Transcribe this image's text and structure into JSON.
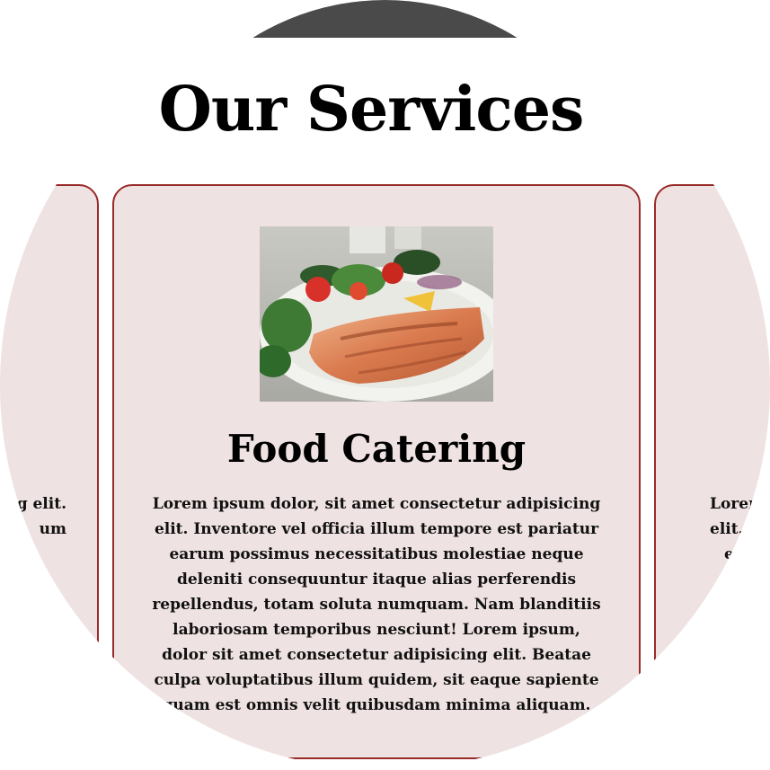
{
  "section": {
    "title": "Our Services"
  },
  "cards": {
    "left": {
      "body": "g elit.\num"
    },
    "center": {
      "image_alt": "Grilled salmon with salad",
      "title": "Food Catering",
      "body": "Lorem ipsum dolor, sit amet consectetur adipisicing elit. Inventore vel officia illum tempore est pariatur earum possimus necessitatibus molestiae neque deleniti consequuntur itaque alias perferendis repellendus, totam soluta numquam. Nam blanditiis laboriosam temporibus nesciunt! Lorem ipsum, dolor sit amet consectetur adipisicing elit. Beatae culpa voluptatibus illum quidem, sit eaque sapiente quam est omnis velit quibusdam minima aliquam."
    },
    "right": {
      "body_line1": "Lorem",
      "body_line2": "elit. I",
      "body_line3": "e"
    }
  },
  "colors": {
    "card_background": "#efe2e2",
    "card_border": "#9a2a2a",
    "top_arc": "#4a4a4a"
  }
}
